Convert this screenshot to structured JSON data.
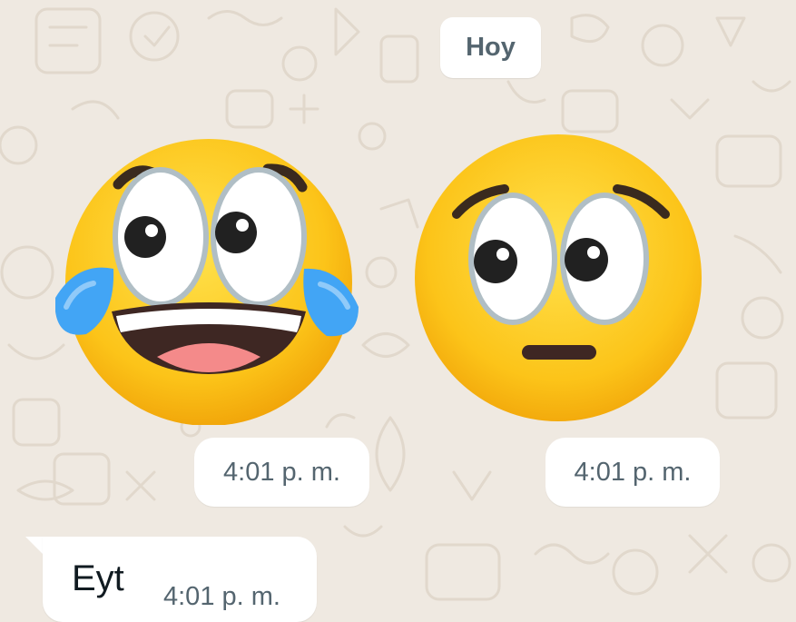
{
  "chat": {
    "date_separator": "Hoy",
    "stickers": [
      {
        "icon": "laughing-crying-eyes-emoji-sticker",
        "time": "4:01 p. m."
      },
      {
        "icon": "worried-big-eyes-emoji-sticker",
        "time": "4:01 p. m."
      }
    ],
    "messages": [
      {
        "text": "Eyt",
        "time": "4:01 p. m."
      }
    ]
  },
  "colors": {
    "wallpaper": "#efe9e1",
    "bubble": "#ffffff",
    "meta_text": "#54656f",
    "emoji_yellow": "#fcc419",
    "tear_blue": "#42a5f5"
  }
}
